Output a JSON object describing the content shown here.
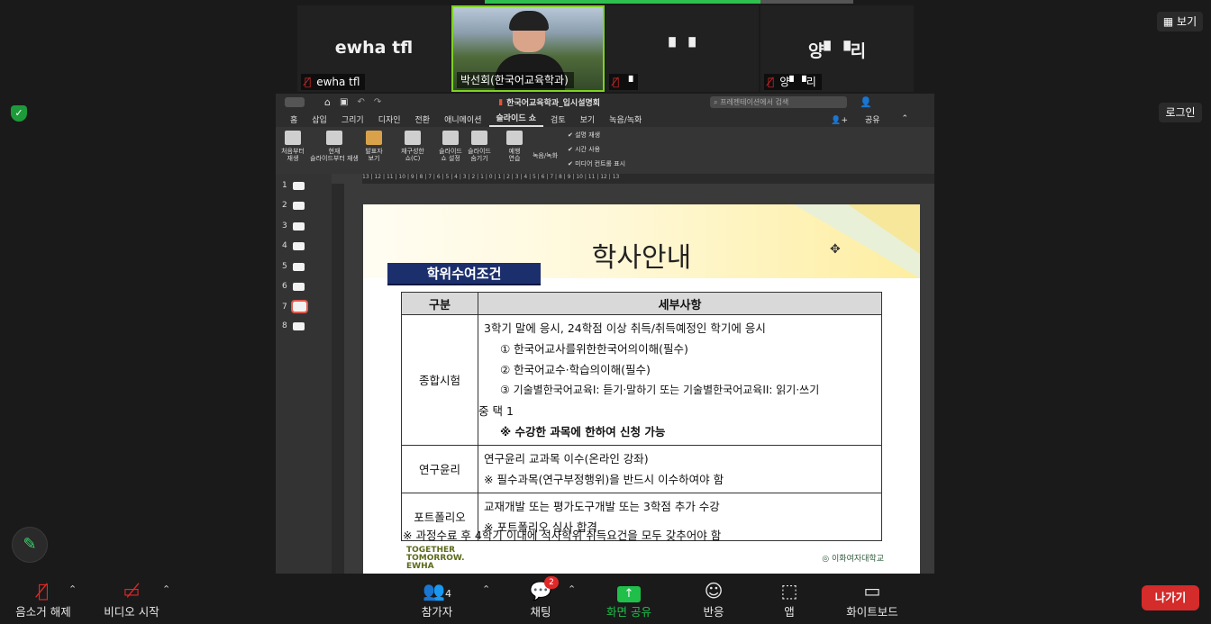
{
  "participants": [
    {
      "big": "ewha tfl",
      "label": "ewha tfl",
      "muted": true
    },
    {
      "big": "",
      "label": "박선회(한국어교육학과)",
      "muted": false,
      "video": true
    },
    {
      "big": "▘▝",
      "label": "▝",
      "muted": true
    },
    {
      "big": "양▘▝리",
      "label": "양▘▝리",
      "muted": true
    }
  ],
  "top_right": {
    "view_label": "보기",
    "login_label": "로그인"
  },
  "ppt": {
    "doc_title": "한국어교육학과_입시설명회",
    "search_placeholder": "프레젠테이션에서 검색",
    "share_label": "공유",
    "menu": [
      "홈",
      "삽입",
      "그리기",
      "디자인",
      "전환",
      "애니메이션",
      "슬라이드 쇼",
      "검토",
      "보기",
      "녹음/녹화"
    ],
    "active_menu": "슬라이드 쇼",
    "ribbon": [
      {
        "label1": "처음부터",
        "label2": "재생"
      },
      {
        "label1": "현재",
        "label2": "슬라이드부터 재생"
      },
      {
        "label1": "발표자",
        "label2": "보기"
      },
      {
        "label1": "재구성한",
        "label2": "쇼(C)"
      },
      {
        "label1": "슬라이드",
        "label2": "쇼 설정"
      },
      {
        "label1": "슬라이드",
        "label2": "숨기기"
      },
      {
        "label1": "예행",
        "label2": "연습"
      },
      {
        "label1": "녹음/녹화",
        "label2": ""
      }
    ],
    "checks": [
      "설명 재생",
      "시간 사용",
      "미디어 컨트롤 표시"
    ],
    "ruler": "13 | 12 | 11 | 10 | 9 | 8 | 7 | 6 | 5 | 4 | 3 | 2 | 1 | 0 | 1 | 2 | 3 | 4 | 5 | 6 | 7 | 8 | 9 | 10 | 11 | 12 | 13",
    "thumbs": [
      "1",
      "2",
      "3",
      "4",
      "5",
      "6",
      "7",
      "8"
    ]
  },
  "slide": {
    "title": "학사안내",
    "badge": "학위수여조건",
    "headers": [
      "구분",
      "세부사항"
    ],
    "rows": [
      {
        "name": "종합시험",
        "lines": [
          "3학기 말에 응시, 24학점 이상 취득/취득예정인 학기에 응시",
          "① 한국어교사를위한한국어의이해(필수)",
          "② 한국어교수·학습의이해(필수)",
          "③ 기술별한국어교육I: 듣기·말하기 또는 기술별한국어교육II: 읽기·쓰기",
          "중 택 1",
          "※ 수강한 과목에 한하여 신청 가능"
        ]
      },
      {
        "name": "연구윤리",
        "lines": [
          "연구윤리 교과목 이수(온라인 강좌)",
          "※ 필수과목(연구부정행위)을 반드시 이수하여야 함"
        ]
      },
      {
        "name": "포트폴리오",
        "lines": [
          "교재개발 또는 평가도구개발 또는 3학점 추가 수강",
          "※ 포트폴리오 심사 합격"
        ]
      }
    ],
    "footnote": "※ 과정수료 후 4학기 이내에 석사학위 취득요건을 모두 갖추어야 함",
    "logo_left": "TOGETHER TOMORROW. EWHA",
    "logo_right": "이화여자대학교"
  },
  "controls": {
    "mute": "음소거 해제",
    "video": "비디오 시작",
    "participants": "참가자",
    "participants_count": "4",
    "chat": "채팅",
    "chat_badge": "2",
    "share": "화면 공유",
    "reactions": "반응",
    "apps": "앱",
    "whiteboard": "화이트보드",
    "leave": "나가기"
  }
}
